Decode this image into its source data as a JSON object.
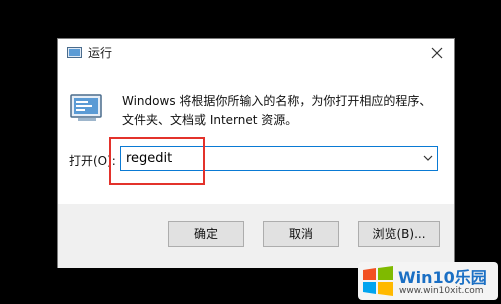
{
  "window": {
    "title": "运行",
    "description": "Windows 将根据你所输入的名称，为你打开相应的程序、文件夹、文档或 Internet 资源。"
  },
  "open": {
    "label": "打开(O):",
    "value": "regedit"
  },
  "buttons": {
    "ok": "确定",
    "cancel": "取消",
    "browse": "浏览(B)..."
  },
  "watermark": {
    "title": "Win10乐园",
    "url": "www.win10xit.com"
  },
  "colors": {
    "highlight": "#e3322b",
    "focus": "#0a7ad4",
    "watermark": "#1a6fc4"
  },
  "icons": {
    "title": "run-icon",
    "close": "close-icon",
    "dropdown": "chevron-down-icon",
    "program": "run-program-icon",
    "logo": "windows-logo-icon"
  }
}
